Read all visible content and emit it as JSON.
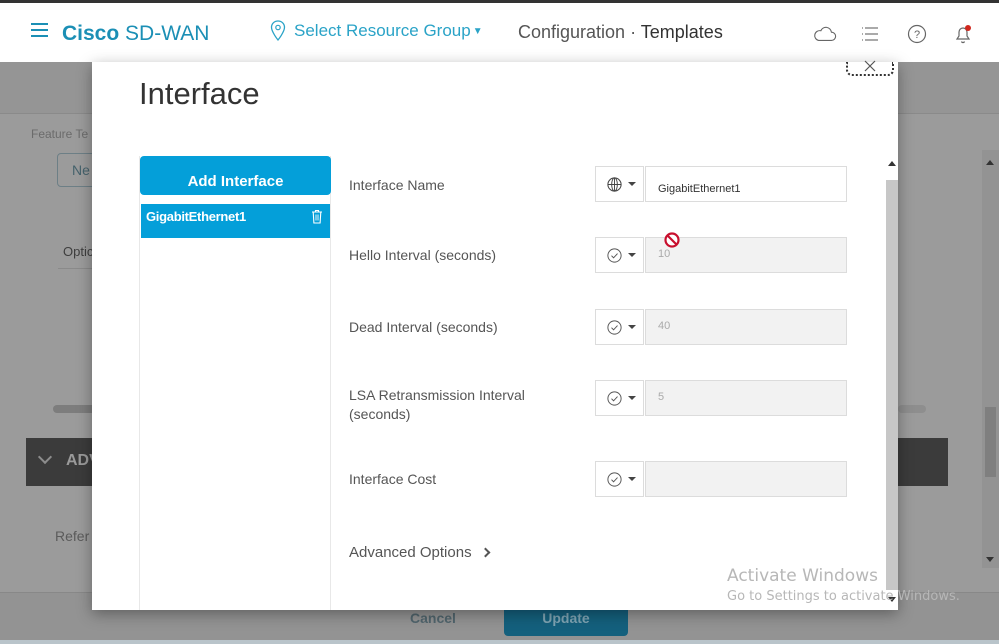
{
  "header": {
    "brand_bold": "Cisco",
    "brand_rest": "SD-WAN",
    "resource_group": "Select Resource Group",
    "breadcrumb_section": "Configuration",
    "breadcrumb_sep": "·",
    "breadcrumb_page": "Templates",
    "icons": [
      "menu-icon",
      "location-pin-icon",
      "cloud-icon",
      "list-icon",
      "help-icon",
      "bell-icon"
    ],
    "brand_color": "#1b8fb5",
    "notification_color": "#d0271d"
  },
  "background": {
    "feature_label": "Feature Te",
    "new_button": "Ne",
    "option_header": "Optic",
    "advanced_section": "ADV",
    "reference_text": "Refer",
    "cancel_label": "Cancel",
    "update_label": "Update"
  },
  "modal": {
    "title": "Interface",
    "add_interface_label": "Add Interface",
    "accent_color": "#049fd9",
    "interfaces": [
      {
        "name": "GigabitEthernet1"
      }
    ],
    "fields": [
      {
        "label": "Interface Name",
        "scope": "global",
        "value": "GigabitEthernet1",
        "disabled": false
      },
      {
        "label": "Hello Interval (seconds)",
        "scope": "default",
        "value": "10",
        "disabled": true
      },
      {
        "label": "Dead Interval (seconds)",
        "scope": "default",
        "value": "40",
        "disabled": true
      },
      {
        "label_line1": "LSA Retransmission Interval",
        "label_line2": "(seconds)",
        "scope": "default",
        "value": "5",
        "disabled": true
      },
      {
        "label": "Interface Cost",
        "scope": "default",
        "value": "",
        "disabled": true
      }
    ],
    "advanced_options_label": "Advanced Options"
  },
  "watermark": {
    "line1": "Activate Windows",
    "line2": "Go to Settings to activate Windows."
  }
}
